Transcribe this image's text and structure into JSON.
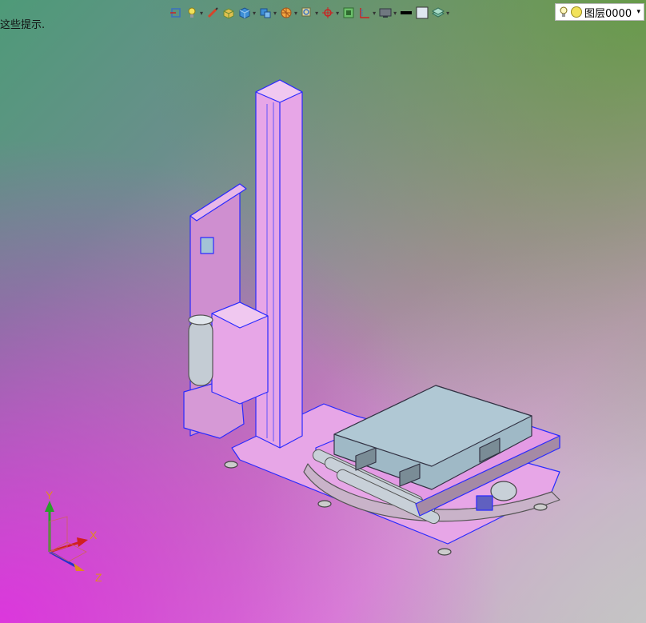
{
  "hint_text": "这些提示.",
  "layer_selector": {
    "name": "图层0000",
    "icons": [
      "lightbulb-icon",
      "sun-icon"
    ]
  },
  "toolbar": {
    "buttons": [
      "view-exit-icon",
      "light-icon",
      "pen-icon",
      "box-shading-icon",
      "cube-icon",
      "view-cube-icon",
      "section-color-icon",
      "zoom-icon",
      "axis-pivot-icon",
      "fit-view-icon",
      "ruler-icon",
      "monitor-icon",
      "black-swatch-icon",
      "white-swatch-icon",
      "layer-stack-icon"
    ]
  },
  "axes": {
    "y_label": "Y",
    "x_label": "X",
    "z_label": "Z"
  },
  "colors": {
    "model_pink": "#e49be5",
    "edge_blue": "#2a2aff",
    "pallet_gray": "#9fb9c6",
    "roller_gray": "#c8d0d8"
  }
}
